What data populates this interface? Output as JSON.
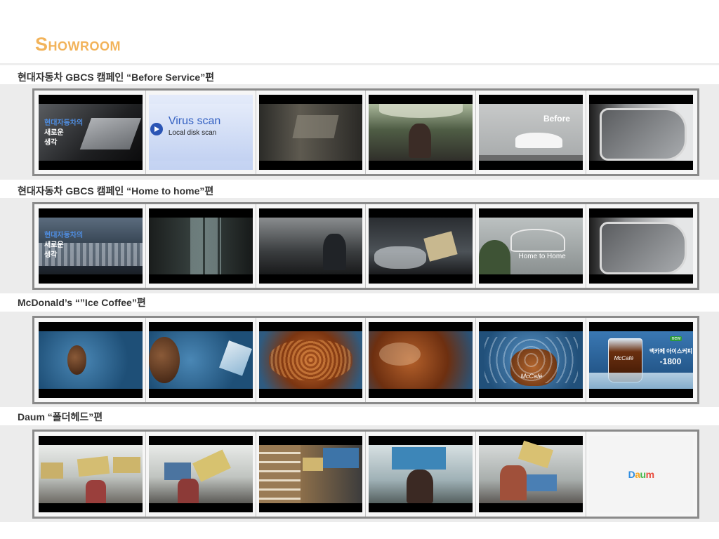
{
  "page": {
    "title_initial": "S",
    "title_rest": "HOWROOM",
    "title_color": "#f2b35a"
  },
  "sections": [
    {
      "title": "현대자동차 GBCS 캠페인 “Before Service”편",
      "frames": [
        {
          "kind": "laptop",
          "text": [
            "현대자동차의",
            "새로운",
            "생각"
          ]
        },
        {
          "kind": "virus-scan",
          "text": [
            "Virus scan",
            "Local disk scan"
          ]
        },
        {
          "kind": "dark-room"
        },
        {
          "kind": "cafe-woman"
        },
        {
          "kind": "car-mural",
          "text": [
            "Before"
          ]
        },
        {
          "kind": "side-mirror"
        }
      ]
    },
    {
      "title": "현대자동차 GBCS 캠페인 “Home to home”편",
      "frames": [
        {
          "kind": "hangers",
          "text": [
            "현대자동차의",
            "새로운",
            "생각"
          ]
        },
        {
          "kind": "house-interior"
        },
        {
          "kind": "kitchen-man"
        },
        {
          "kind": "clothes-box"
        },
        {
          "kind": "car-mural-2",
          "text": [
            "Home to Home"
          ]
        },
        {
          "kind": "side-mirror"
        }
      ]
    },
    {
      "title": "McDonald’s “”Ice Coffee”편",
      "frames": [
        {
          "kind": "bean"
        },
        {
          "kind": "bean-ice"
        },
        {
          "kind": "splash"
        },
        {
          "kind": "splash-2"
        },
        {
          "kind": "cup-splash",
          "text": [
            "McCafé"
          ]
        },
        {
          "kind": "product-shot",
          "text": [
            "new",
            "맥카페 아이스커피",
            "-1800",
            "McCafé"
          ]
        }
      ]
    },
    {
      "title": "Daum “폴더헤드”편",
      "frames": [
        {
          "kind": "office-boxes"
        },
        {
          "kind": "office-boxes-2"
        },
        {
          "kind": "library"
        },
        {
          "kind": "blue-box-girl"
        },
        {
          "kind": "box-stack"
        },
        {
          "kind": "logo",
          "text": [
            "Daum"
          ]
        }
      ]
    }
  ]
}
